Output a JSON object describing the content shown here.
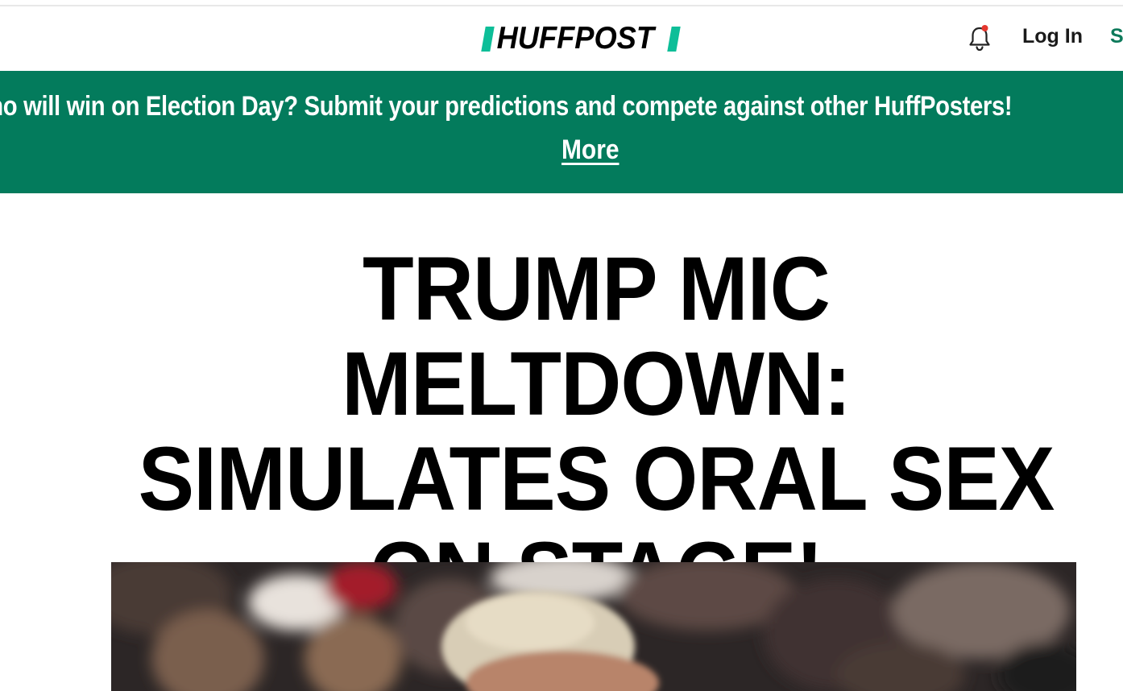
{
  "header": {
    "logo_text": "HUFFPOST",
    "login_label": "Log In",
    "signup_label_partial": "S"
  },
  "icons": {
    "notifications": "bell-icon"
  },
  "banner": {
    "text": "Who will win on Election Day? Submit your predictions and compete against other HuffPosters!",
    "more_label": "More"
  },
  "article": {
    "headline": "TRUMP MIC MELTDOWN: SIMULATES ORAL SEX ON STAGE!"
  },
  "colors": {
    "brand_accent": "#0dbe98",
    "banner_bg": "#037b5c",
    "signup_text": "#0d7a5b",
    "notification_dot": "#e5372e"
  }
}
